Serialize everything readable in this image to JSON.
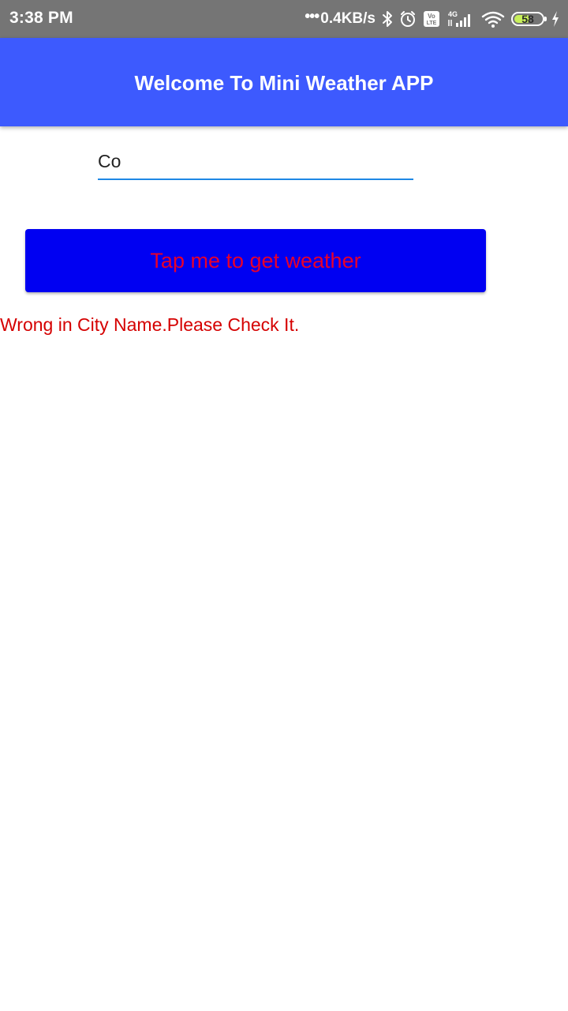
{
  "status_bar": {
    "time": "3:38 PM",
    "network_speed": "0.4KB/s",
    "network_type": "4G",
    "volte": "Vo LTE",
    "battery_level": "58",
    "battery_fraction": 0.58,
    "icons": [
      "dots-icon",
      "bluetooth-icon",
      "alarm-icon",
      "volte-icon",
      "signal-icon",
      "wifi-icon",
      "battery-icon",
      "charging-icon"
    ]
  },
  "app_bar": {
    "title": "Welcome To Mini Weather APP",
    "color": "#3d5afe"
  },
  "city_input": {
    "value": "Co",
    "underline_color": "#1e88e5"
  },
  "action_button": {
    "label": "Tap me to get weather",
    "background": "#0000f2",
    "text_color": "#e8002b"
  },
  "message": {
    "text": "Wrong in City Name.Please Check It.",
    "color": "#d50000"
  }
}
